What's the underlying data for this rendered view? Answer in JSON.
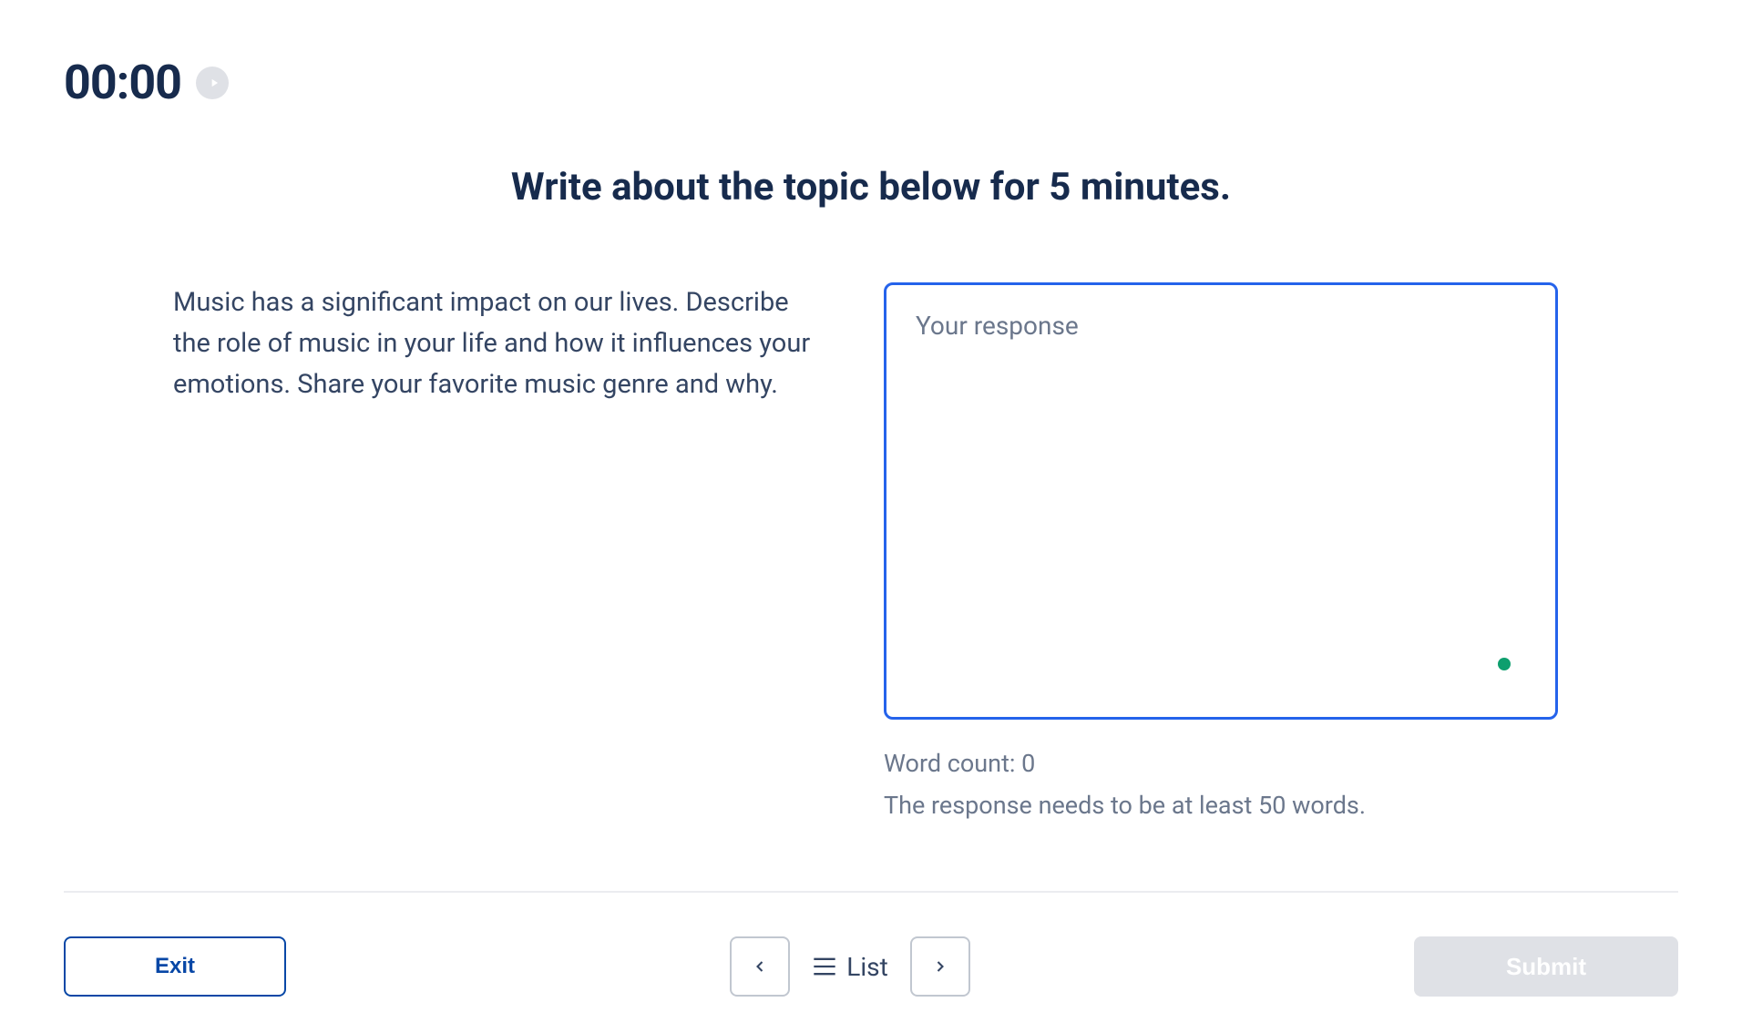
{
  "timer": {
    "display": "00:00"
  },
  "instruction": "Write about the topic below for 5 minutes.",
  "prompt": {
    "text": "Music has a significant impact on our lives. Describe the role of music in your life and how it influences your emotions. Share your favorite music genre and why."
  },
  "response": {
    "placeholder": "Your response",
    "value": "",
    "word_count_label": "Word count: 0",
    "min_words_text": "The response needs to be at least 50 words."
  },
  "footer": {
    "exit_label": "Exit",
    "list_label": "List",
    "submit_label": "Submit"
  }
}
